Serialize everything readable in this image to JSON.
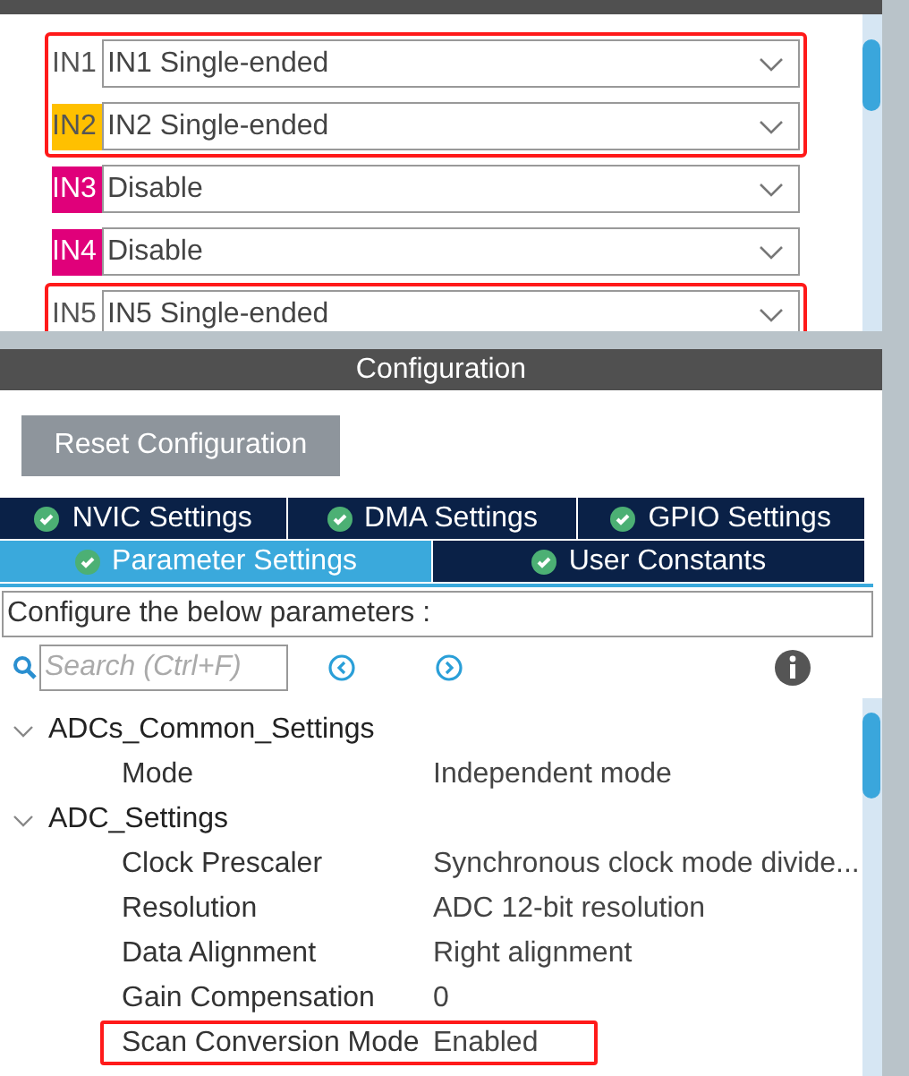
{
  "mode": {
    "groups": [
      {
        "highlighted": true,
        "rows": [
          {
            "label": "IN1",
            "value": "IN1 Single-ended"
          },
          {
            "label": "IN2",
            "color": "#ffc000",
            "value": "IN2 Single-ended"
          }
        ]
      },
      {
        "highlighted": false,
        "rows": [
          {
            "label": "IN3",
            "color": "#e0007a",
            "value": "Disable"
          },
          {
            "label": "IN4",
            "color": "#e0007a",
            "value": "Disable"
          }
        ]
      },
      {
        "highlighted": true,
        "rows": [
          {
            "label": "IN5",
            "value": "IN5 Single-ended"
          }
        ]
      }
    ]
  },
  "configuration": {
    "title": "Configuration",
    "reset_button": "Reset Configuration",
    "tabs": [
      [
        {
          "label": "NVIC Settings",
          "selected": false
        },
        {
          "label": "DMA Settings",
          "selected": false
        },
        {
          "label": "GPIO Settings",
          "selected": false
        }
      ],
      [
        {
          "label": "Parameter Settings",
          "selected": true
        },
        {
          "label": "User Constants",
          "selected": false
        }
      ]
    ],
    "description": "Configure the below parameters :",
    "search": {
      "placeholder": "Search (Ctrl+F)"
    },
    "tree": [
      {
        "label": "ADCs_Common_Settings",
        "expanded": true,
        "children": [
          {
            "name": "Mode",
            "value": "Independent mode",
            "highlighted": false
          }
        ]
      },
      {
        "label": "ADC_Settings",
        "expanded": true,
        "children": [
          {
            "name": "Clock Prescaler",
            "value": "Synchronous clock mode divide...",
            "highlighted": false
          },
          {
            "name": "Resolution",
            "value": "ADC 12-bit resolution",
            "highlighted": false
          },
          {
            "name": "Data Alignment",
            "value": "Right alignment",
            "highlighted": false
          },
          {
            "name": "Gain Compensation",
            "value": "0",
            "highlighted": false
          },
          {
            "name": "Scan Conversion Mode",
            "value": "Enabled",
            "highlighted": true
          }
        ]
      }
    ]
  }
}
